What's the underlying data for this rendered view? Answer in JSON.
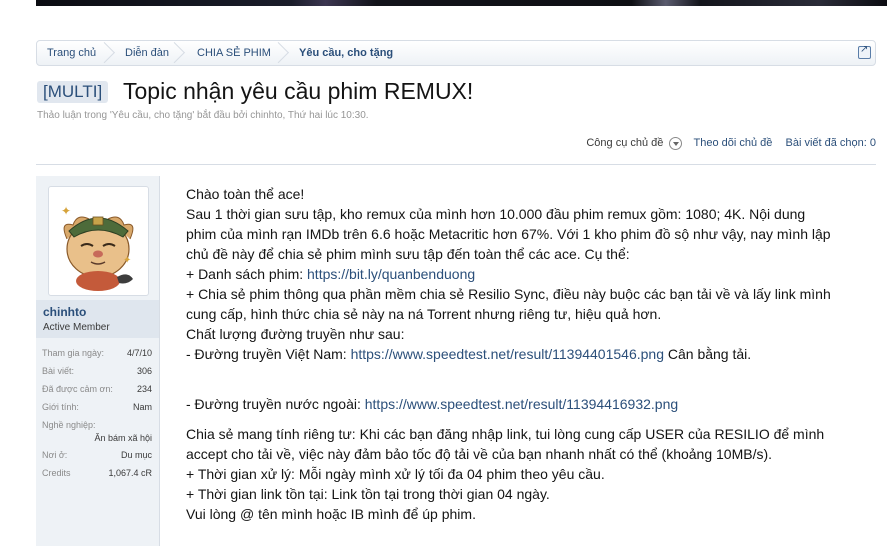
{
  "breadcrumb": {
    "items": [
      "Trang chủ",
      "Diễn đàn",
      "CHIA SẺ PHIM",
      "Yêu cầu, cho tặng"
    ]
  },
  "thread": {
    "prefix": "[MULTI]",
    "title": "Topic nhận yêu cầu phim REMUX!",
    "meta": "Thảo luận trong 'Yêu cầu, cho tặng' bắt đầu bởi chinhto, Thứ hai lúc 10:30.",
    "tools": {
      "menu": "Công cụ chủ đề",
      "watch": "Theo dõi chủ đề",
      "selected": "Bài viết đã chọn: 0"
    }
  },
  "user": {
    "name": "chinhto",
    "title": "Active Member",
    "stats": [
      {
        "label": "Tham gia ngày:",
        "value": "4/7/10"
      },
      {
        "label": "Bài viết:",
        "value": "306"
      },
      {
        "label": "Đã được cảm ơn:",
        "value": "234"
      },
      {
        "label": "Giới tính:",
        "value": "Nam"
      },
      {
        "label": "Nghề nghiệp:",
        "value": "Ăn bám xã hội"
      },
      {
        "label": "Nơi ở:",
        "value": "Du mục"
      },
      {
        "label": "Credits",
        "value": "1,067.4 cR"
      }
    ]
  },
  "post": {
    "greeting": "Chào toàn thể ace!",
    "intro": [
      "Sau 1 thời gian sưu tập, kho remux của mình hơn 10.000 đầu phim remux gồm: 1080; 4K. Nội dung",
      "phim của mình rạn IMDb trên 6.6 hoặc Metacritic hơn 67%. Với 1 kho phim đồ sộ như vậy, nay mình lập",
      "chủ đề này để chia sẻ phim mình sưu tập đến toàn thể các ace. Cụ thể:"
    ],
    "list_label": "+ Danh sách phim: ",
    "list_link": "https://bit.ly/quanbenduong",
    "share": [
      "+ Chia sẻ phim thông qua phần mềm chia sẻ Resilio Sync, điều này buộc các bạn tải về và lấy link mình",
      "cung cấp, hình thức chia sẻ này na ná Torrent nhưng riêng tư, hiệu quả hơn."
    ],
    "quality": "Chất lượng đường truyền như sau:",
    "vn_label": "- Đường truyền Việt Nam: ",
    "vn_link": "https://www.speedtest.net/result/11394401546.png",
    "vn_suffix": " Cân bằng tải.",
    "intl_label": "- Đường truyền nước ngoài: ",
    "intl_link": "https://www.speedtest.net/result/11394416932.png",
    "private": [
      "Chia sẻ mang tính riêng tư: Khi các bạn đăng nhập link, tui lòng cung cấp USER của RESILIO để mình",
      "accept cho tải về, việc này đảm bảo tốc độ tải về của bạn nhanh nhất có thể (khoảng 10MB/s)."
    ],
    "rules": [
      "+ Thời gian xử lý: Mỗi ngày mình xử lý tối đa 04 phim theo yêu cầu.",
      "+ Thời gian link tồn tại: Link tồn tại trong thời gian 04 ngày."
    ],
    "closing": "Vui lòng @ tên mình hoặc IB mình để úp phim."
  }
}
